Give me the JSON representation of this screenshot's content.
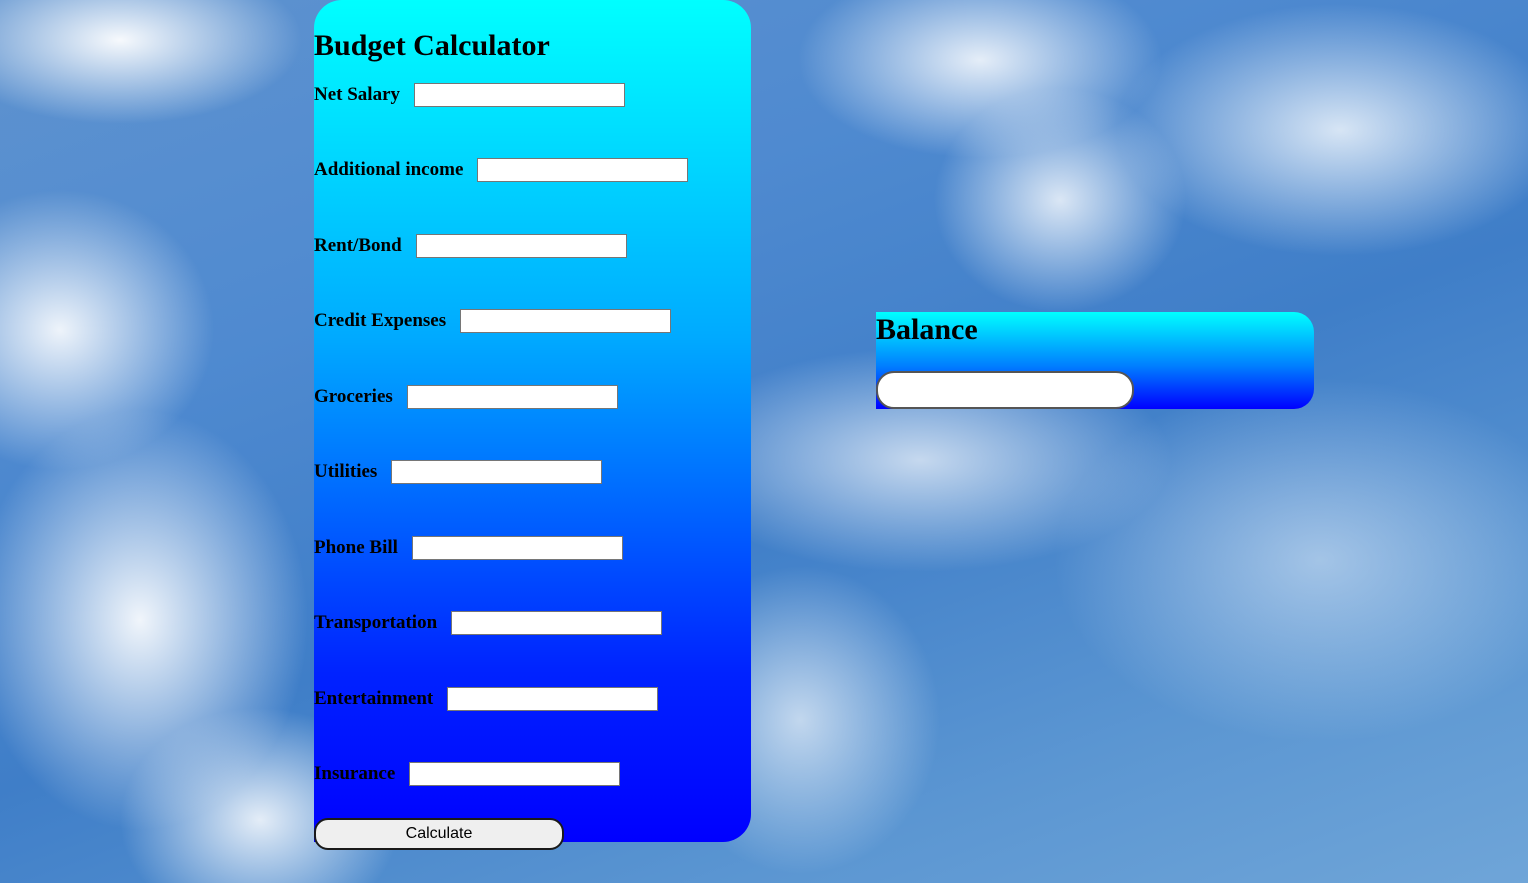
{
  "calculator": {
    "title": "Budget Calculator",
    "fields": [
      {
        "label": "Net Salary",
        "value": ""
      },
      {
        "label": "Additional income",
        "value": ""
      },
      {
        "label": "Rent/Bond",
        "value": ""
      },
      {
        "label": "Credit Expenses",
        "value": ""
      },
      {
        "label": "Groceries",
        "value": ""
      },
      {
        "label": "Utilities",
        "value": ""
      },
      {
        "label": "Phone Bill",
        "value": ""
      },
      {
        "label": "Transportation",
        "value": ""
      },
      {
        "label": "Entertainment",
        "value": ""
      },
      {
        "label": "Insurance",
        "value": ""
      }
    ],
    "button_label": "Calculate"
  },
  "balance": {
    "title": "Balance",
    "value": ""
  },
  "colors": {
    "panel_top": "#00ffff",
    "panel_bottom": "#0000ff"
  }
}
